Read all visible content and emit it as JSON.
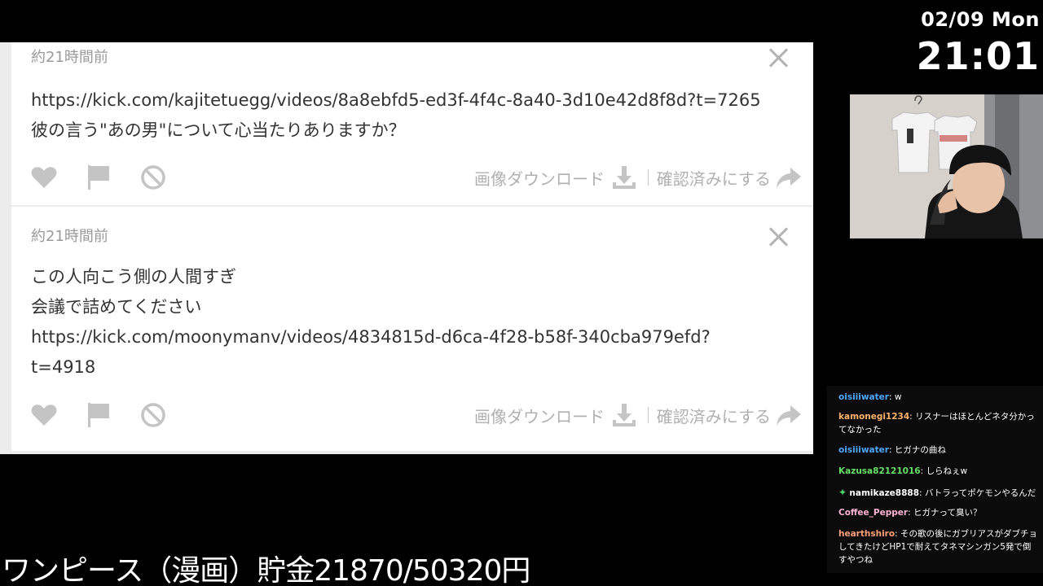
{
  "clock": {
    "date": "02/09 Mon",
    "time": "21:01"
  },
  "cards": [
    {
      "timestamp": "約21時間前",
      "lines": [
        "https://kick.com/kajitetuegg/videos/8a8ebfd5-ed3f-4f4c-8a40-3d10e42d8f8d?t=7265",
        "彼の言う\"あの男\"について心当たりありますか？"
      ],
      "download_label": "画像ダウンロード",
      "confirm_label": "確認済みにする"
    },
    {
      "timestamp": "約21時間前",
      "lines": [
        "この人向こう側の人間すぎ",
        "会議で詰めてください",
        "https://kick.com/moonymanv/videos/4834815d-d6ca-4f28-b58f-340cba979efd?",
        "t=4918"
      ],
      "download_label": "画像ダウンロード",
      "confirm_label": "確認済みにする"
    }
  ],
  "chat": [
    {
      "user": "oisiiiwater",
      "text": "w",
      "color": "#4ea6ff"
    },
    {
      "user": "kamonegi1234",
      "text": "リスナーはほとんどネタ分かってなかった",
      "color": "#ffb26b"
    },
    {
      "user": "oisiiiwater",
      "text": "ヒガナの曲ね",
      "color": "#4ea6ff"
    },
    {
      "user": "Kazusa82121016",
      "text": "しらねぇw",
      "color": "#66e066"
    },
    {
      "user": "namikaze8888",
      "text": "バトラってポケモンやるんだ",
      "color": "#ffffff",
      "badge": "sparkle-badge"
    },
    {
      "user": "Coffee_Pepper",
      "text": "ヒガナって臭い？",
      "color": "#ffb3d1"
    },
    {
      "user": "hearthshiro",
      "text": "その歌の後にガブリアスがダブチョしてきたけどHP1で耐えてタネマシンガン5発で倒すやつね",
      "color": "#ffa07a"
    }
  ],
  "overlay": {
    "savings_text": "ワンピース（漫画）貯金21870/50320円"
  },
  "colors": {
    "icon_gray": "#c4c4c4",
    "panel_bg": "#ececec"
  }
}
